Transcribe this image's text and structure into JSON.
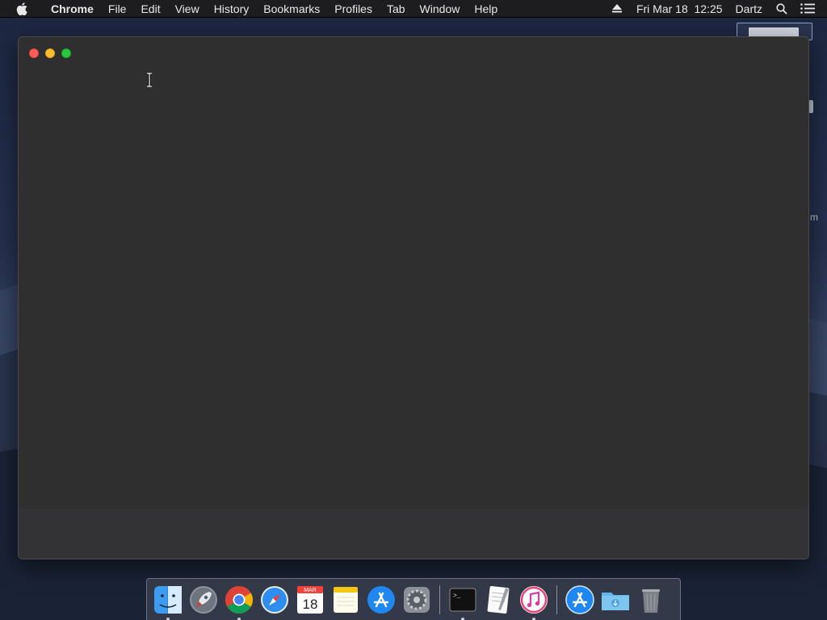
{
  "menubar": {
    "app_name": "Chrome",
    "items": [
      "File",
      "Edit",
      "View",
      "History",
      "Bookmarks",
      "Profiles",
      "Tab",
      "Window",
      "Help"
    ],
    "datetime": "Fri Mar 18  12:25",
    "user": "Dartz"
  },
  "desktop": {
    "partial_label": "m"
  },
  "window": {
    "state": "blank"
  },
  "dock": {
    "items": [
      {
        "name": "Finder",
        "running": true
      },
      {
        "name": "Launchpad",
        "running": false
      },
      {
        "name": "Google Chrome",
        "running": true
      },
      {
        "name": "Safari",
        "running": false
      },
      {
        "name": "Calendar",
        "running": false,
        "month": "MAR",
        "day": "18"
      },
      {
        "name": "Notes",
        "running": false
      },
      {
        "name": "App Store",
        "running": false
      },
      {
        "name": "System Preferences",
        "running": false
      },
      {
        "name": "Terminal",
        "running": true,
        "prompt": ">_"
      },
      {
        "name": "TextEdit",
        "running": false
      },
      {
        "name": "iTunes",
        "running": true
      },
      {
        "name": "Applications",
        "running": false
      },
      {
        "name": "Downloads",
        "running": false
      },
      {
        "name": "Trash",
        "running": false
      }
    ]
  }
}
